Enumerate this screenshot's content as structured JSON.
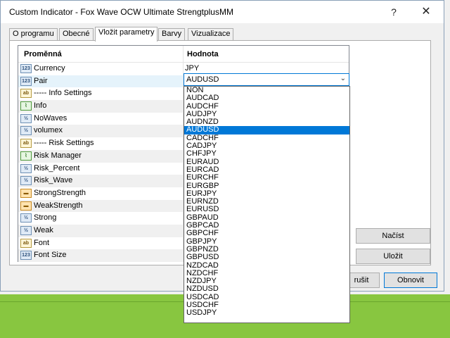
{
  "window": {
    "title": "Custom Indicator - Fox Wave OCW Ultimate StrengtplusMM",
    "help_glyph": "?",
    "close_glyph": "✕"
  },
  "tabs": [
    {
      "label": "O programu",
      "active": false
    },
    {
      "label": "Obecné",
      "active": false
    },
    {
      "label": "Vložit parametry",
      "active": true
    },
    {
      "label": "Barvy",
      "active": false
    },
    {
      "label": "Vizualizace",
      "active": false
    }
  ],
  "grid": {
    "col_variable": "Proměnná",
    "col_value": "Hodnota",
    "rows": [
      {
        "icon": "123",
        "name": "Currency",
        "value": "JPY"
      },
      {
        "icon": "123",
        "name": "Pair",
        "value": ""
      },
      {
        "icon": "ab",
        "name": "----- Info   Settings",
        "value": ""
      },
      {
        "icon": "chart",
        "name": "Info",
        "value": ""
      },
      {
        "icon": "1/2",
        "name": "NoWaves",
        "value": ""
      },
      {
        "icon": "1/2",
        "name": "volumex",
        "value": ""
      },
      {
        "icon": "ab",
        "name": "----- Risk    Settings",
        "value": ""
      },
      {
        "icon": "chart",
        "name": "Risk Manager",
        "value": ""
      },
      {
        "icon": "1/2",
        "name": "Risk_Percent",
        "value": ""
      },
      {
        "icon": "1/2",
        "name": "Risk_Wave",
        "value": ""
      },
      {
        "icon": "color",
        "name": "StrongStrength",
        "value": ""
      },
      {
        "icon": "color",
        "name": "WeakStrength",
        "value": ""
      },
      {
        "icon": "1/2",
        "name": "Strong",
        "value": ""
      },
      {
        "icon": "1/2",
        "name": "Weak",
        "value": ""
      },
      {
        "icon": "ab",
        "name": "Font",
        "value": ""
      },
      {
        "icon": "123",
        "name": "Font Size",
        "value": ""
      }
    ]
  },
  "pair_combo": {
    "selected": "AUDUSD",
    "arrow": "⌄",
    "options": [
      "NON",
      "AUDCAD",
      "AUDCHF",
      "AUDJPY",
      "AUDNZD",
      "AUDUSD",
      "CADCHF",
      "CADJPY",
      "CHFJPY",
      "EURAUD",
      "EURCAD",
      "EURCHF",
      "EURGBP",
      "EURJPY",
      "EURNZD",
      "EURUSD",
      "GBPAUD",
      "GBPCAD",
      "GBPCHF",
      "GBPJPY",
      "GBPNZD",
      "GBPUSD",
      "NZDCAD",
      "NZDCHF",
      "NZDJPY",
      "NZDUSD",
      "USDCAD",
      "USDCHF",
      "USDJPY"
    ]
  },
  "buttons": {
    "load": "Načíst",
    "save": "Uložit",
    "cancel": "Zrušit",
    "cancel_visible": "rušit",
    "ok": "Obnovit"
  }
}
